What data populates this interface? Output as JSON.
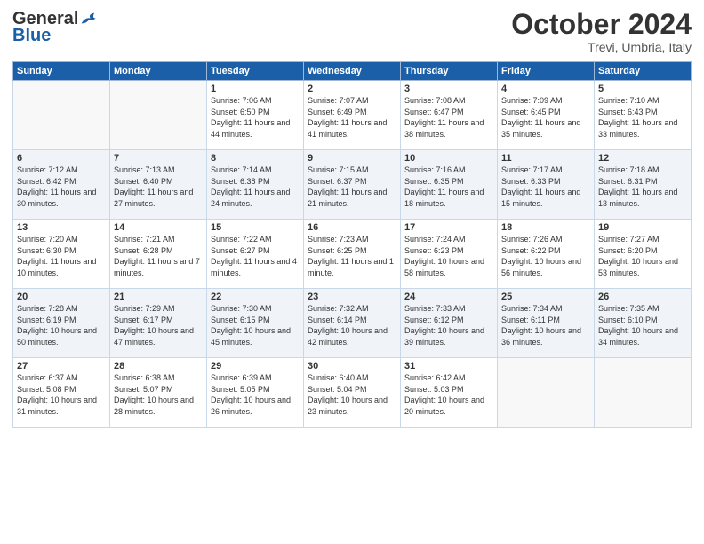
{
  "header": {
    "logo_line1": "General",
    "logo_line2": "Blue",
    "month": "October 2024",
    "location": "Trevi, Umbria, Italy"
  },
  "weekdays": [
    "Sunday",
    "Monday",
    "Tuesday",
    "Wednesday",
    "Thursday",
    "Friday",
    "Saturday"
  ],
  "weeks": [
    [
      {
        "day": "",
        "content": ""
      },
      {
        "day": "",
        "content": ""
      },
      {
        "day": "1",
        "content": "Sunrise: 7:06 AM\nSunset: 6:50 PM\nDaylight: 11 hours and 44 minutes."
      },
      {
        "day": "2",
        "content": "Sunrise: 7:07 AM\nSunset: 6:49 PM\nDaylight: 11 hours and 41 minutes."
      },
      {
        "day": "3",
        "content": "Sunrise: 7:08 AM\nSunset: 6:47 PM\nDaylight: 11 hours and 38 minutes."
      },
      {
        "day": "4",
        "content": "Sunrise: 7:09 AM\nSunset: 6:45 PM\nDaylight: 11 hours and 35 minutes."
      },
      {
        "day": "5",
        "content": "Sunrise: 7:10 AM\nSunset: 6:43 PM\nDaylight: 11 hours and 33 minutes."
      }
    ],
    [
      {
        "day": "6",
        "content": "Sunrise: 7:12 AM\nSunset: 6:42 PM\nDaylight: 11 hours and 30 minutes."
      },
      {
        "day": "7",
        "content": "Sunrise: 7:13 AM\nSunset: 6:40 PM\nDaylight: 11 hours and 27 minutes."
      },
      {
        "day": "8",
        "content": "Sunrise: 7:14 AM\nSunset: 6:38 PM\nDaylight: 11 hours and 24 minutes."
      },
      {
        "day": "9",
        "content": "Sunrise: 7:15 AM\nSunset: 6:37 PM\nDaylight: 11 hours and 21 minutes."
      },
      {
        "day": "10",
        "content": "Sunrise: 7:16 AM\nSunset: 6:35 PM\nDaylight: 11 hours and 18 minutes."
      },
      {
        "day": "11",
        "content": "Sunrise: 7:17 AM\nSunset: 6:33 PM\nDaylight: 11 hours and 15 minutes."
      },
      {
        "day": "12",
        "content": "Sunrise: 7:18 AM\nSunset: 6:31 PM\nDaylight: 11 hours and 13 minutes."
      }
    ],
    [
      {
        "day": "13",
        "content": "Sunrise: 7:20 AM\nSunset: 6:30 PM\nDaylight: 11 hours and 10 minutes."
      },
      {
        "day": "14",
        "content": "Sunrise: 7:21 AM\nSunset: 6:28 PM\nDaylight: 11 hours and 7 minutes."
      },
      {
        "day": "15",
        "content": "Sunrise: 7:22 AM\nSunset: 6:27 PM\nDaylight: 11 hours and 4 minutes."
      },
      {
        "day": "16",
        "content": "Sunrise: 7:23 AM\nSunset: 6:25 PM\nDaylight: 11 hours and 1 minute."
      },
      {
        "day": "17",
        "content": "Sunrise: 7:24 AM\nSunset: 6:23 PM\nDaylight: 10 hours and 58 minutes."
      },
      {
        "day": "18",
        "content": "Sunrise: 7:26 AM\nSunset: 6:22 PM\nDaylight: 10 hours and 56 minutes."
      },
      {
        "day": "19",
        "content": "Sunrise: 7:27 AM\nSunset: 6:20 PM\nDaylight: 10 hours and 53 minutes."
      }
    ],
    [
      {
        "day": "20",
        "content": "Sunrise: 7:28 AM\nSunset: 6:19 PM\nDaylight: 10 hours and 50 minutes."
      },
      {
        "day": "21",
        "content": "Sunrise: 7:29 AM\nSunset: 6:17 PM\nDaylight: 10 hours and 47 minutes."
      },
      {
        "day": "22",
        "content": "Sunrise: 7:30 AM\nSunset: 6:15 PM\nDaylight: 10 hours and 45 minutes."
      },
      {
        "day": "23",
        "content": "Sunrise: 7:32 AM\nSunset: 6:14 PM\nDaylight: 10 hours and 42 minutes."
      },
      {
        "day": "24",
        "content": "Sunrise: 7:33 AM\nSunset: 6:12 PM\nDaylight: 10 hours and 39 minutes."
      },
      {
        "day": "25",
        "content": "Sunrise: 7:34 AM\nSunset: 6:11 PM\nDaylight: 10 hours and 36 minutes."
      },
      {
        "day": "26",
        "content": "Sunrise: 7:35 AM\nSunset: 6:10 PM\nDaylight: 10 hours and 34 minutes."
      }
    ],
    [
      {
        "day": "27",
        "content": "Sunrise: 6:37 AM\nSunset: 5:08 PM\nDaylight: 10 hours and 31 minutes."
      },
      {
        "day": "28",
        "content": "Sunrise: 6:38 AM\nSunset: 5:07 PM\nDaylight: 10 hours and 28 minutes."
      },
      {
        "day": "29",
        "content": "Sunrise: 6:39 AM\nSunset: 5:05 PM\nDaylight: 10 hours and 26 minutes."
      },
      {
        "day": "30",
        "content": "Sunrise: 6:40 AM\nSunset: 5:04 PM\nDaylight: 10 hours and 23 minutes."
      },
      {
        "day": "31",
        "content": "Sunrise: 6:42 AM\nSunset: 5:03 PM\nDaylight: 10 hours and 20 minutes."
      },
      {
        "day": "",
        "content": ""
      },
      {
        "day": "",
        "content": ""
      }
    ]
  ]
}
